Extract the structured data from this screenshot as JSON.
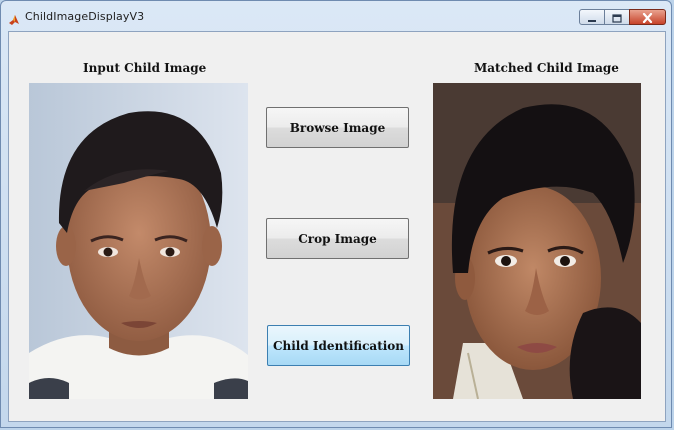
{
  "window": {
    "title": "ChildImageDisplayV3",
    "controls": {
      "minimize": "minimize-icon",
      "maximize": "maximize-icon",
      "close": "close-icon"
    }
  },
  "left_panel": {
    "heading": "Input Child Image"
  },
  "right_panel": {
    "heading": "Matched Child Image"
  },
  "buttons": {
    "browse": "Browse Image",
    "crop": "Crop Image",
    "identify": "Child Identification"
  },
  "colors": {
    "close": "#c7432a",
    "focused_button": "#bee6fd"
  }
}
